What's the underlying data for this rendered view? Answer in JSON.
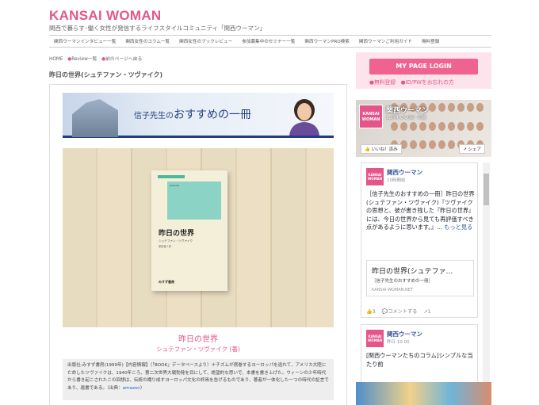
{
  "site": {
    "logo": "KANSAI WOMAN",
    "tagline": "関西で暮らす･働く女性が発信するライフスタイルコミュニティ「関西ウーマン」"
  },
  "nav": [
    "関西ウーマンインタビュー一覧",
    "関西女性のコラム一覧",
    "関西女性のブックレビュー",
    "参加募集中のセミナー一覧",
    "関西ウーマンPRO検索",
    "関西ウーマンご利用ガイド",
    "無料登録"
  ],
  "breadcrumb": {
    "home": "HOME",
    "review": "Review一覧",
    "back": "前のページへ戻る"
  },
  "page_title": "昨日の世界(シュテファン・ツヴァイク)",
  "banner": {
    "prefix": "信子先生の",
    "main": "おすすめの一冊"
  },
  "book": {
    "title": "昨日の世界",
    "author": "シュテファン・ツヴァイク",
    "author_credit": "シュテファン・ツヴァイク (著)",
    "publisher": "みすず書房",
    "cover_author": "シュテファン・ツヴァイク",
    "translator": "原田義人訳",
    "cover_text": "Autorail"
  },
  "description": {
    "text": "出版社:みすず書房(1999年)【内容情報】（「BOOK」データベースより）ナチズムが席巻するヨーロッパを逃れて、アメリカ大陸に亡命したツヴァイクは、1940年ころ、第二次世界大戦勃発を目にして、絶望的な思いで、本書を書き上げた。ウィーンの少年時代から書き起こされたこの回想は、伝統の織り成すヨーロッパ文化の終焉を告げるものであり、著者が一体化した一つの時代の証言であり、遺書である。（出典：",
    "link": "amazon",
    "end": "）"
  },
  "login": {
    "button": "MY PAGE LOGIN",
    "register": "無料登録",
    "forgot": "ID/PWをお忘れの方"
  },
  "fb": {
    "name": "関西ウーマン",
    "likes": "1,274 いいね！の数",
    "like_btn": "いいね！済み",
    "share_btn": "シェア",
    "logo": "KANSAI WOMAN"
  },
  "posts": [
    {
      "name": "関西ウーマン",
      "time": "10時間前",
      "text": "［信子先生のおすすめの一冊］昨日の世界(シュテファン・ツヴァイク)『ツヴァイクの思想と、彼が書き残した『昨日の世界』には、今日の世界から見ても再評価すべき点があるように思います。』...",
      "more": "もっと見る",
      "card_title": "昨日の世界(シュテファ...",
      "card_sub": "［信子先生のおすすめの一冊］",
      "card_url": "KANSAI-WOMAN.NET",
      "likes": "3",
      "comment": "コメントする",
      "share": "1"
    },
    {
      "name": "関西ウーマン",
      "time": "昨日 10:00",
      "text": "[関西ウーマンたちのコラム]シンプルな当たり前"
    }
  ]
}
